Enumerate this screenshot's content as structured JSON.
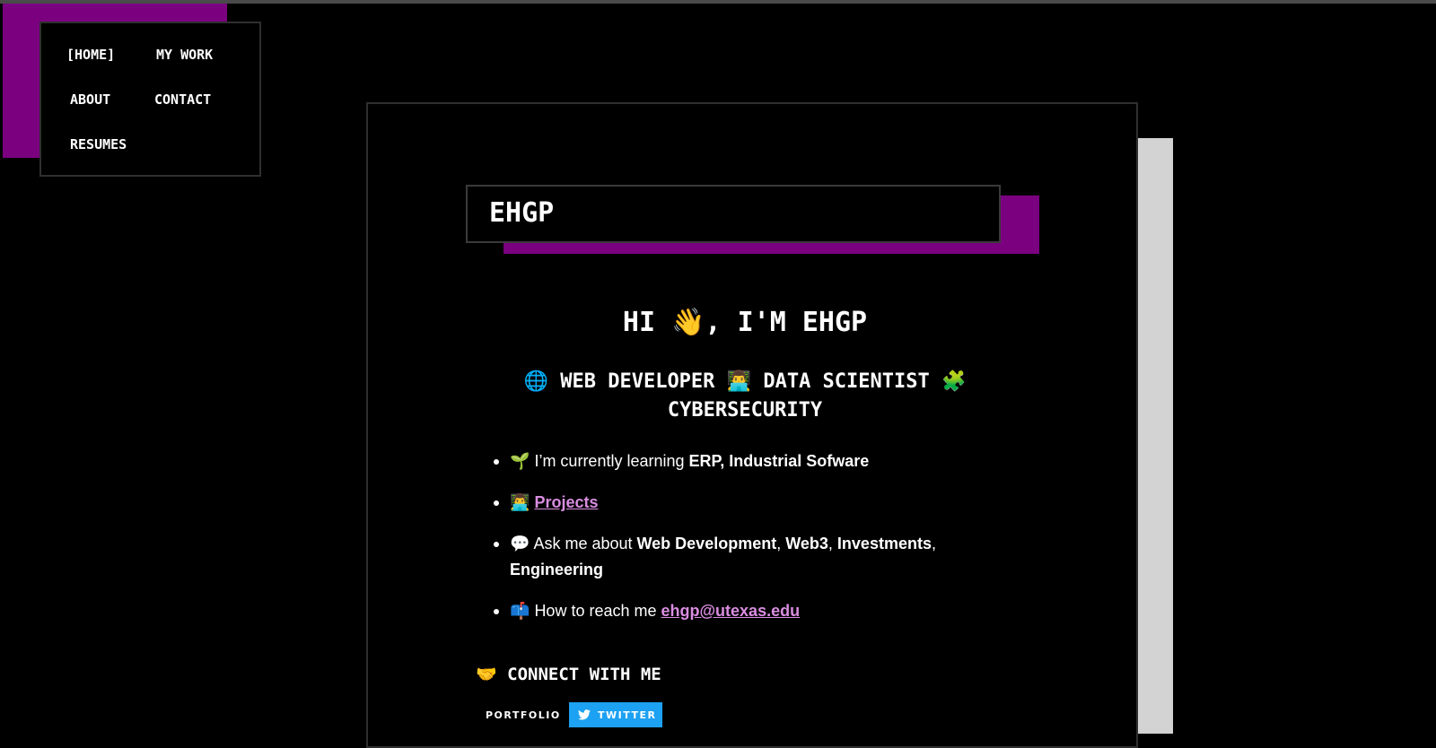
{
  "nav": {
    "home": "[HOME]",
    "my_work": "MY WORK",
    "about": "ABOUT",
    "contact": "CONTACT",
    "resumes": "RESUMES"
  },
  "header": {
    "site_title": "EHGP"
  },
  "intro": {
    "greeting_pre": "HI ",
    "greeting_emoji": "👋",
    "greeting_post": ", I'M EHGP",
    "role_web_emoji": "🌐",
    "role_web": "WEB DEVELOPER",
    "role_data_emoji": "👨‍💻",
    "role_data": "DATA SCIENTIST",
    "role_cyber_emoji": "🧩",
    "role_cyber": "CYBERSECURITY"
  },
  "bullets": {
    "learning_emoji": "🌱",
    "learning_text": "I’m currently learning ",
    "learning_bold": "ERP, Industrial Sofware",
    "projects_emoji": "👨‍💻",
    "projects_link": "Projects",
    "ask_emoji": "💬",
    "ask_text": "Ask me about ",
    "ask_web": "Web Development",
    "ask_web3": "Web3",
    "ask_invest": "Investments",
    "ask_eng": "Engineering",
    "comma": ", ",
    "reach_emoji": "📫",
    "reach_text": "How to reach me ",
    "reach_email": "ehgp@utexas.edu"
  },
  "connect": {
    "emoji": "🤝",
    "heading": "CONNECT WITH ME",
    "portfolio_label": "PORTFOLIO",
    "twitter_label": "TWITTER"
  },
  "colors": {
    "accent_purple": "#7b0080",
    "link_purple": "#d98de0",
    "twitter_blue": "#1da1f2",
    "card_shadow": "#d3d3d3"
  }
}
